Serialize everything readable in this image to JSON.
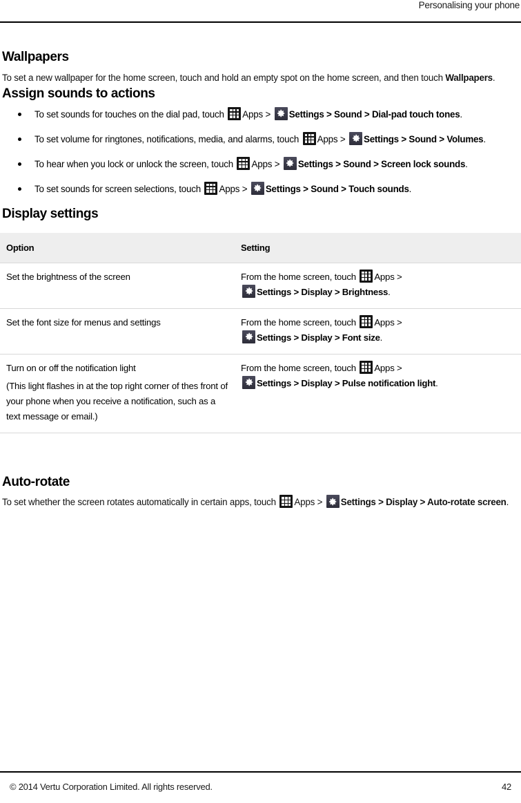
{
  "header": {
    "running_title": "Personalising your phone"
  },
  "sections": {
    "wallpapers": {
      "heading": "Wallpapers",
      "body_part1": "To set a new wallpaper for the home screen, touch and hold an empty spot on the home screen, and then touch ",
      "body_bold": "Wallpapers",
      "body_part2": "."
    },
    "assign_sounds": {
      "heading": "Assign sounds to actions",
      "bullets": [
        {
          "lead": "To set sounds for touches on the dial pad, touch ",
          "apps_label": "Apps",
          "sep1": " > ",
          "settings_label": "Settings",
          "sep2": " > ",
          "path1": "Sound",
          "sep3": " > ",
          "path2": "Dial-pad touch tones",
          "end": "."
        },
        {
          "lead": "To set volume for ringtones, notifications, media, and alarms, touch ",
          "apps_label": "Apps",
          "sep1": " > ",
          "settings_label": "Settings",
          "sep2": " > ",
          "path1": "Sound",
          "sep3": " > ",
          "path2": "Volumes",
          "end": "."
        },
        {
          "lead": "To hear when you lock or unlock the screen, touch ",
          "apps_label": "Apps",
          "sep1": " > ",
          "settings_label": "Settings",
          "sep2": " > ",
          "path1": "Sound",
          "sep3": " > ",
          "path2": "Screen lock sounds",
          "end": "."
        },
        {
          "lead": "To set sounds for screen selections, touch ",
          "apps_label": "Apps",
          "sep1": " > ",
          "settings_label": "Settings",
          "sep2": " > ",
          "path1": "Sound",
          "sep3": " > ",
          "path2": "Touch sounds",
          "end": "."
        }
      ]
    },
    "display_settings": {
      "heading": "Display settings",
      "table": {
        "columns": [
          "Option",
          "Setting"
        ],
        "rows": [
          {
            "option_line1": "Set the brightness of the screen",
            "option_line2": "",
            "setting": {
              "lead": "From the home screen, touch ",
              "apps_label": "Apps",
              "sep1": " > ",
              "settings_label": "Settings",
              "sep2": " > ",
              "path1": "Display",
              "sep3": " > ",
              "path2": "Brightness",
              "end": "."
            }
          },
          {
            "option_line1": "Set the font size for menus and settings",
            "option_line2": "",
            "setting": {
              "lead": "From the home screen, touch ",
              "apps_label": "Apps",
              "sep1": " > ",
              "settings_label": "Settings",
              "sep2": " > ",
              "path1": "Display",
              "sep3": " > ",
              "path2": "Font size",
              "end": "."
            }
          },
          {
            "option_line1": "Turn on or off the notification light",
            "option_line2": "(This light flashes in at the top right corner of thes front of your phone when you receive a notification, such as a text message or email.)",
            "setting": {
              "lead": "From the home screen, touch ",
              "apps_label": "Apps",
              "sep1": " > ",
              "settings_label": "Settings",
              "sep2": " > ",
              "path1": "Display",
              "sep3": " > ",
              "path2": "Pulse notification light",
              "end": "."
            }
          }
        ]
      }
    },
    "auto_rotate": {
      "heading": "Auto-rotate",
      "lead": "To set whether the screen rotates automatically in certain apps, touch ",
      "apps_label": "Apps",
      "sep1": " > ",
      "settings_label": "Settings",
      "sep2": " > ",
      "path1": "Display",
      "sep3": " > ",
      "path2": "Auto-rotate screen",
      "end": "."
    }
  },
  "footer": {
    "copyright": "© 2014 Vertu Corporation Limited. All rights reserved.",
    "page_number": "42"
  },
  "colors": {
    "apps_icon_bg": "#141414",
    "settings_icon_bg": "#3a3a48",
    "table_header_bg": "#eeeeee",
    "rule": "#000000",
    "table_border": "#d8d8d8"
  }
}
